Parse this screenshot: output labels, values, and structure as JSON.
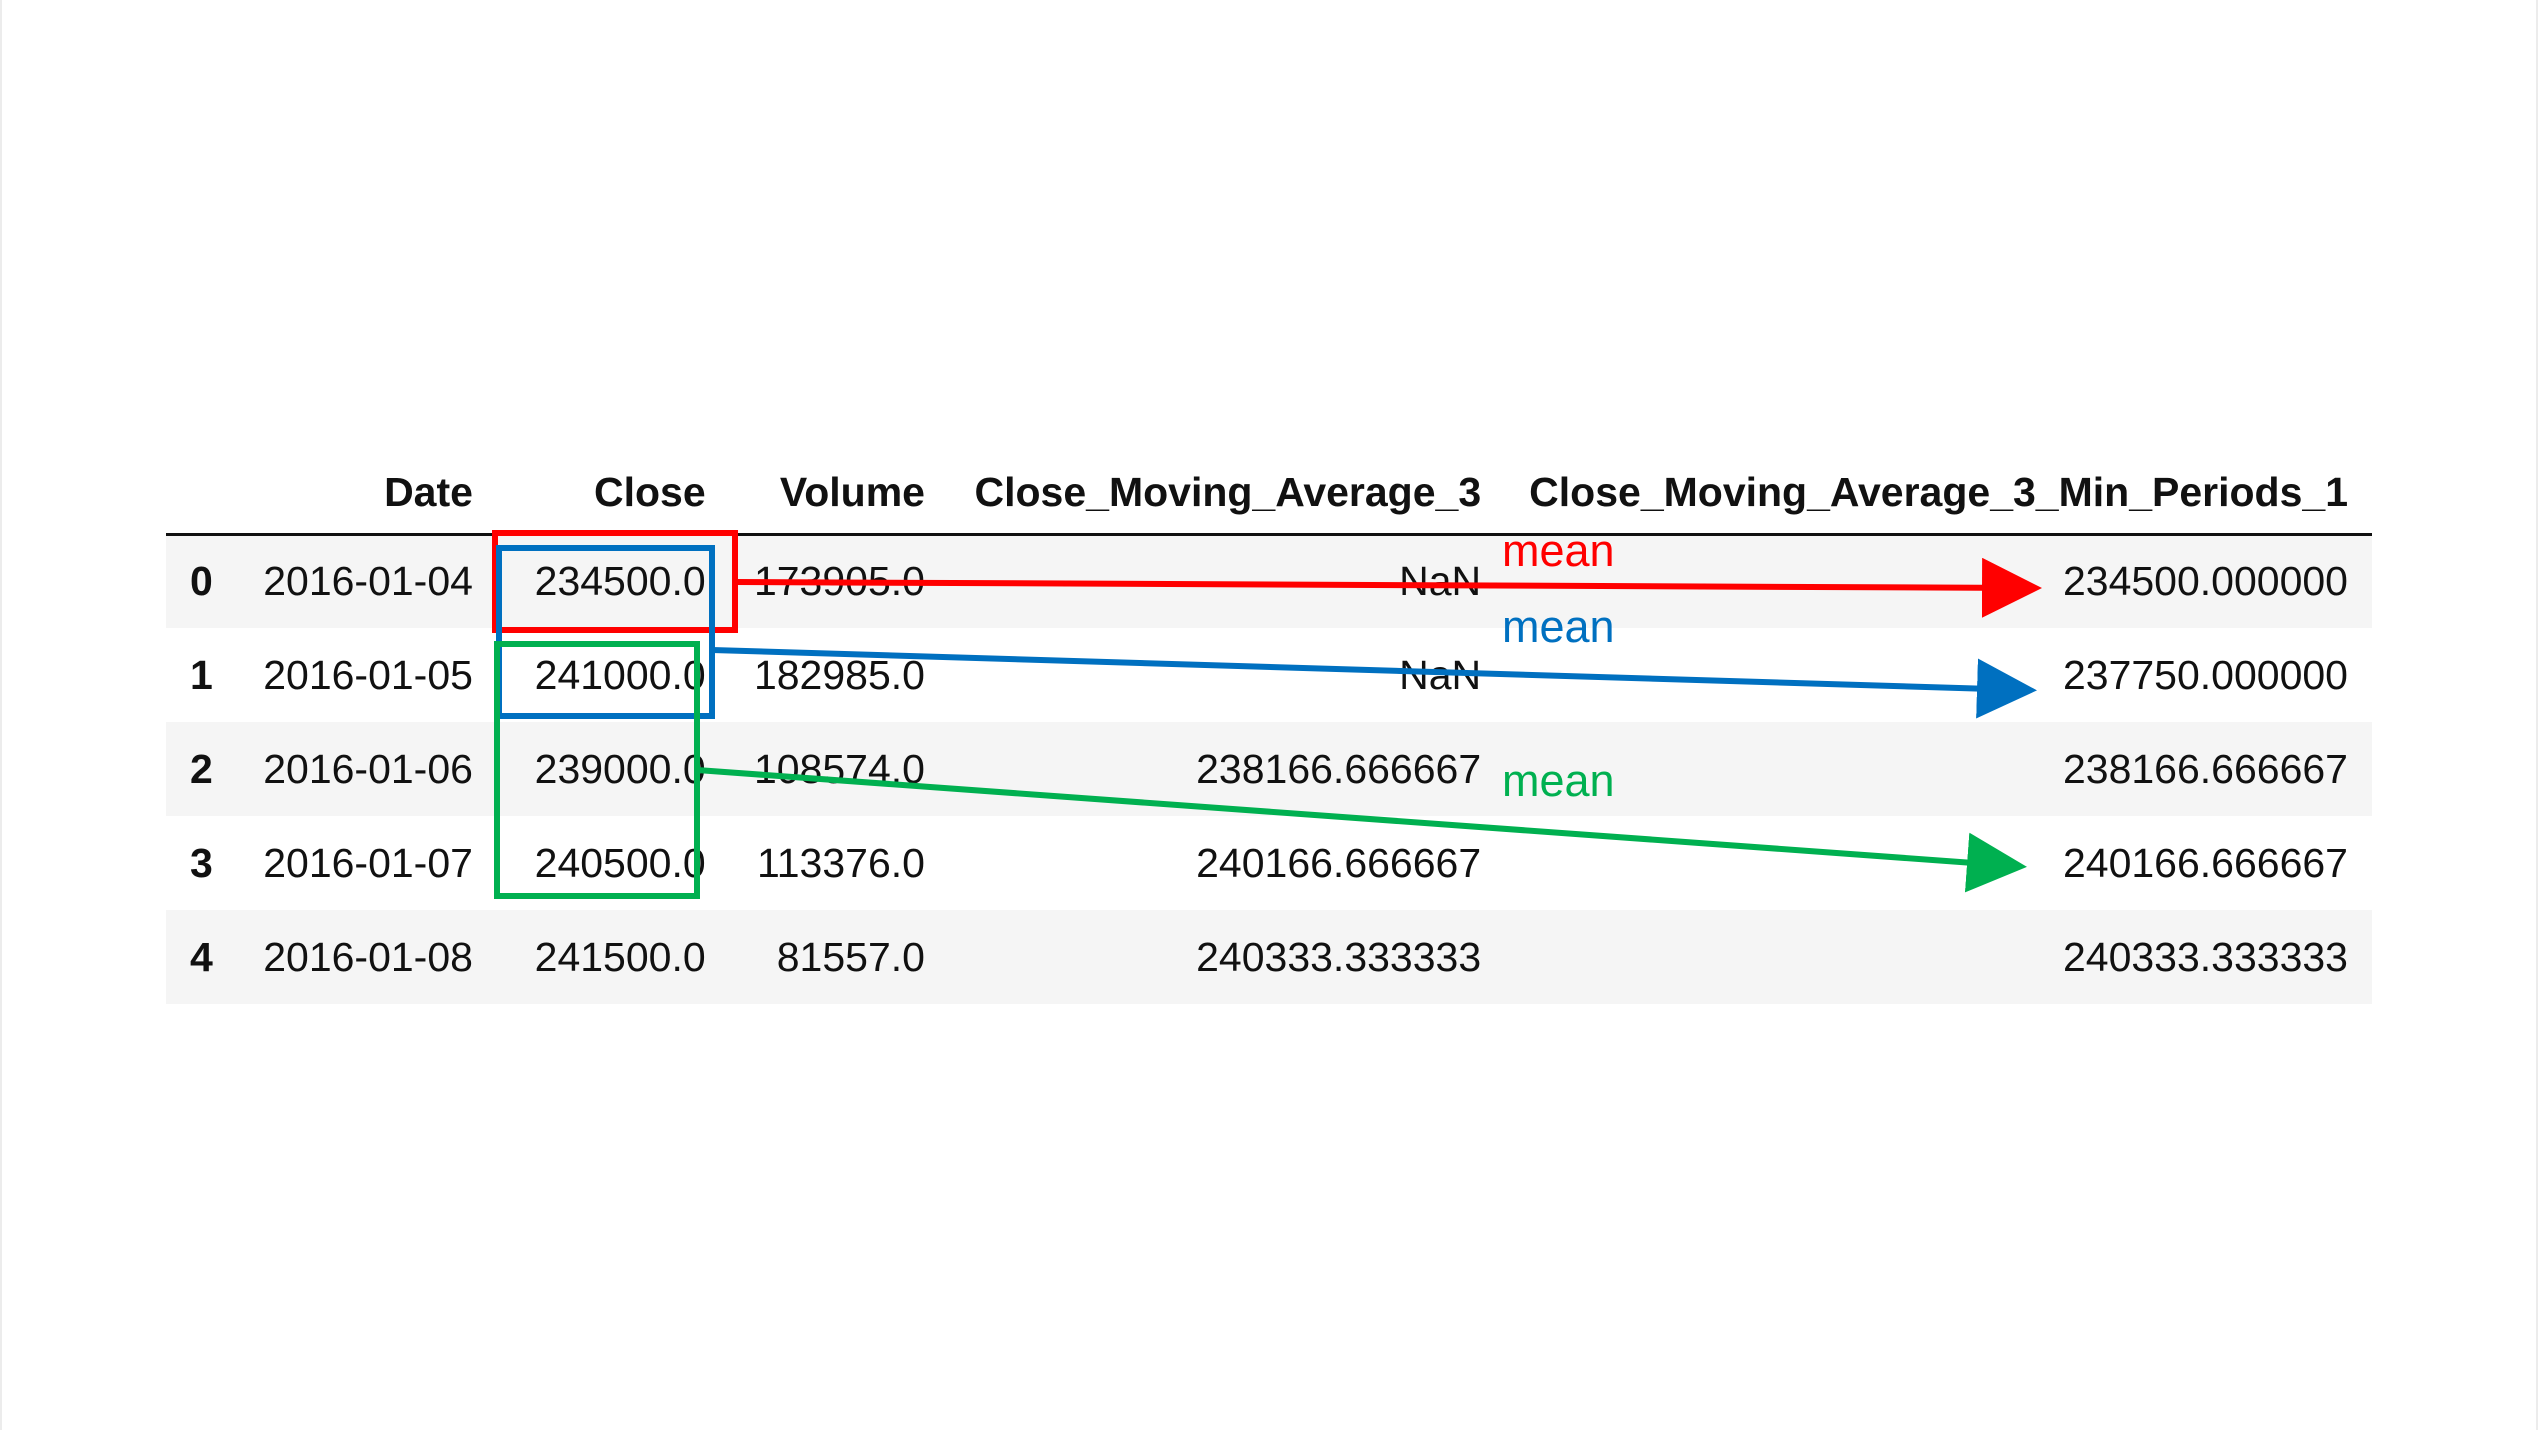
{
  "table": {
    "columns": [
      "",
      "Date",
      "Close",
      "Volume",
      "Close_Moving_Average_3",
      "Close_Moving_Average_3_Min_Periods_1"
    ],
    "rows": [
      {
        "index": "0",
        "date": "2016-01-04",
        "close": "234500.0",
        "volume": "173905.0",
        "ma3": "NaN",
        "ma3_min1": "234500.000000"
      },
      {
        "index": "1",
        "date": "2016-01-05",
        "close": "241000.0",
        "volume": "182985.0",
        "ma3": "NaN",
        "ma3_min1": "237750.000000"
      },
      {
        "index": "2",
        "date": "2016-01-06",
        "close": "239000.0",
        "volume": "108574.0",
        "ma3": "238166.666667",
        "ma3_min1": "238166.666667"
      },
      {
        "index": "3",
        "date": "2016-01-07",
        "close": "240500.0",
        "volume": "113376.0",
        "ma3": "240166.666667",
        "ma3_min1": "240166.666667"
      },
      {
        "index": "4",
        "date": "2016-01-08",
        "close": "241500.0",
        "volume": "81557.0",
        "ma3": "240333.333333",
        "ma3_min1": "240333.333333"
      }
    ]
  },
  "annotations": [
    {
      "label": "mean",
      "color": "#ff0000"
    },
    {
      "label": "mean",
      "color": "#0070c0"
    },
    {
      "label": "mean",
      "color": "#00b050"
    }
  ]
}
